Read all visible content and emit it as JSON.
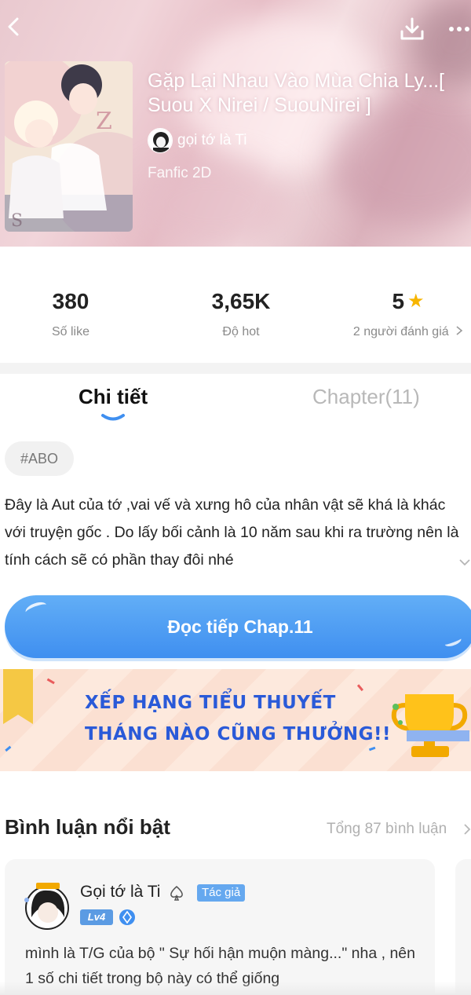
{
  "header": {
    "title": "Gặp Lại Nhau Vào Mùa Chia Ly...[ Suou X Nirei / SuouNirei ]",
    "author": "gọi tớ là Ti",
    "genre": "Fanfic 2D"
  },
  "stats": {
    "likes": {
      "value": "380",
      "label": "Số like"
    },
    "hot": {
      "value": "3,65K",
      "label": "Độ hot"
    },
    "rating": {
      "value": "5",
      "label": "2 người đánh giá"
    }
  },
  "tabs": {
    "detail": "Chi tiết",
    "chapter": "Chapter(11)"
  },
  "detail": {
    "tag": "#ABO",
    "description": "Đây là Aut của tớ ,vai vế và xưng hô của nhân vật sẽ khá là khác với truyện gốc . Do lấy bối cảnh là 10 năm sau khi ra trường nên là tính cách sẽ có phần thay đôi nhé",
    "read_button": "Đọc tiếp Chap.11"
  },
  "banner": {
    "line1": "XẾP HẠNG TIỂU THUYẾT",
    "line2": "THÁNG NÀO CŨNG THƯỞNG!!"
  },
  "comments": {
    "title": "Bình luận nổi bật",
    "total": "Tổng 87 bình luận",
    "items": [
      {
        "user": "Gọi tớ là Ti",
        "badge": "Tác giả",
        "level": "Lv4",
        "text": "mình là T/G của bộ \" Sự hối hận muộn màng...\" nha , nên 1 số chi tiết trong bộ này có thể giống"
      }
    ]
  },
  "colors": {
    "accent": "#3f8ff0",
    "star": "#f7b500",
    "banner_text": "#2a5ad8"
  },
  "icons": [
    "back-icon",
    "download-icon",
    "more-icon",
    "star-icon",
    "chevron-right-icon",
    "chevron-down-icon",
    "spade-icon",
    "gem-icon",
    "trophy-icon",
    "ribbon-icon"
  ]
}
